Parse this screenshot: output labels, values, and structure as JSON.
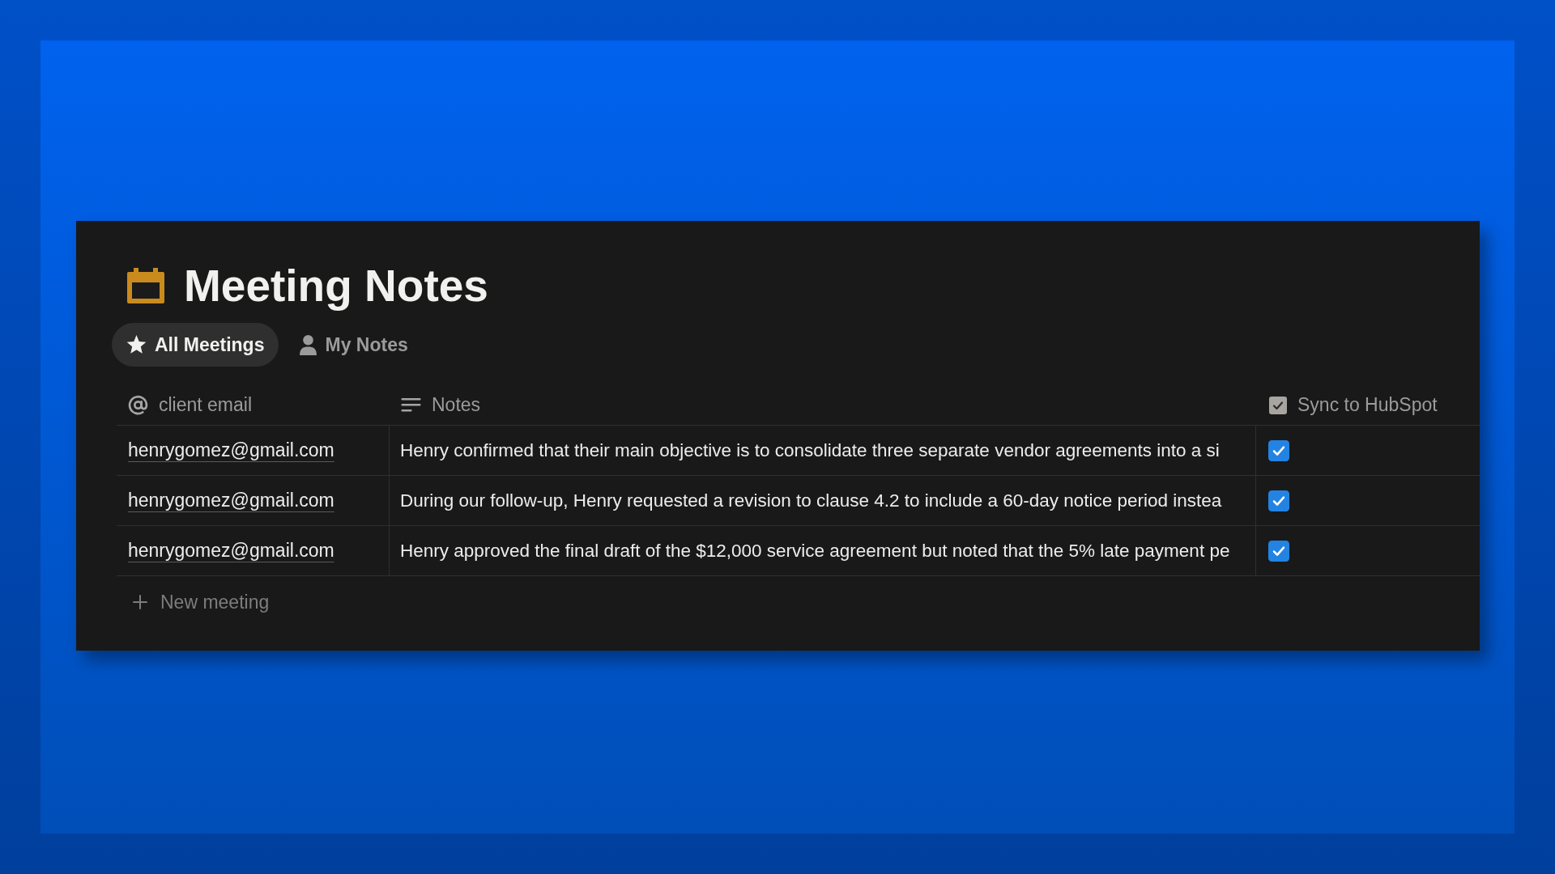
{
  "title": "Meeting Notes",
  "views": [
    {
      "label": "All Meetings",
      "selected": true
    },
    {
      "label": "My Notes",
      "selected": false
    }
  ],
  "table": {
    "columns": [
      {
        "label": "client email",
        "kind": "email"
      },
      {
        "label": "Notes",
        "kind": "text"
      },
      {
        "label": "Sync to HubSpot",
        "kind": "checkbox"
      }
    ],
    "rows": [
      {
        "email": "henrygomez@gmail.com",
        "notes": "Henry confirmed that their main objective is to consolidate three separate vendor agreements into a si",
        "checked": true
      },
      {
        "email": "henrygomez@gmail.com",
        "notes": "During our follow-up, Henry requested a revision to clause 4.2 to include a 60-day notice period instea",
        "checked": true
      },
      {
        "email": "henrygomez@gmail.com",
        "notes": "Henry approved the final draft of the $12,000 service agreement but noted that the 5% late payment pe",
        "checked": true
      }
    ],
    "new_row": "New meeting"
  }
}
